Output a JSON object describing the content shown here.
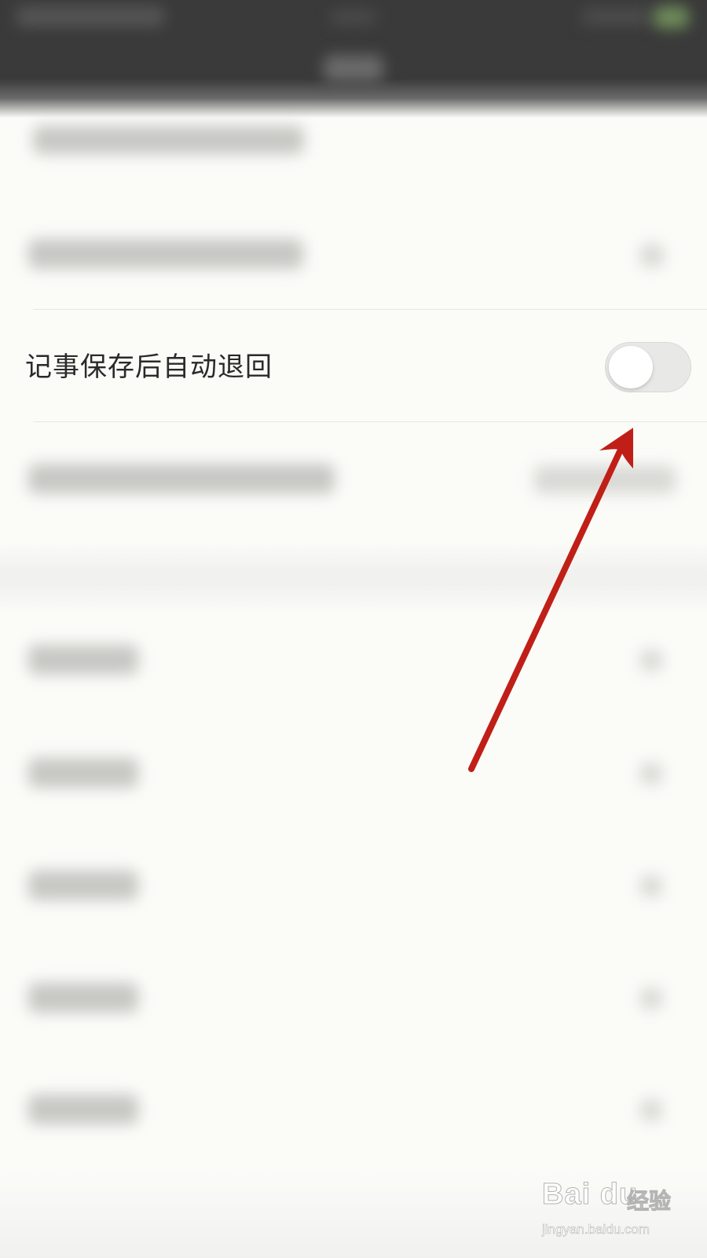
{
  "setting": {
    "label": "记事保存后自动退回",
    "toggle_on": false
  },
  "colors": {
    "toggle_track": "#e8e8e6",
    "annotation_arrow": "#c01f17",
    "status_bar": "#3a3a3a"
  },
  "watermark": {
    "brand": "Bai du",
    "brand_cn": "经验",
    "url": "jingyan.baidu.com"
  }
}
